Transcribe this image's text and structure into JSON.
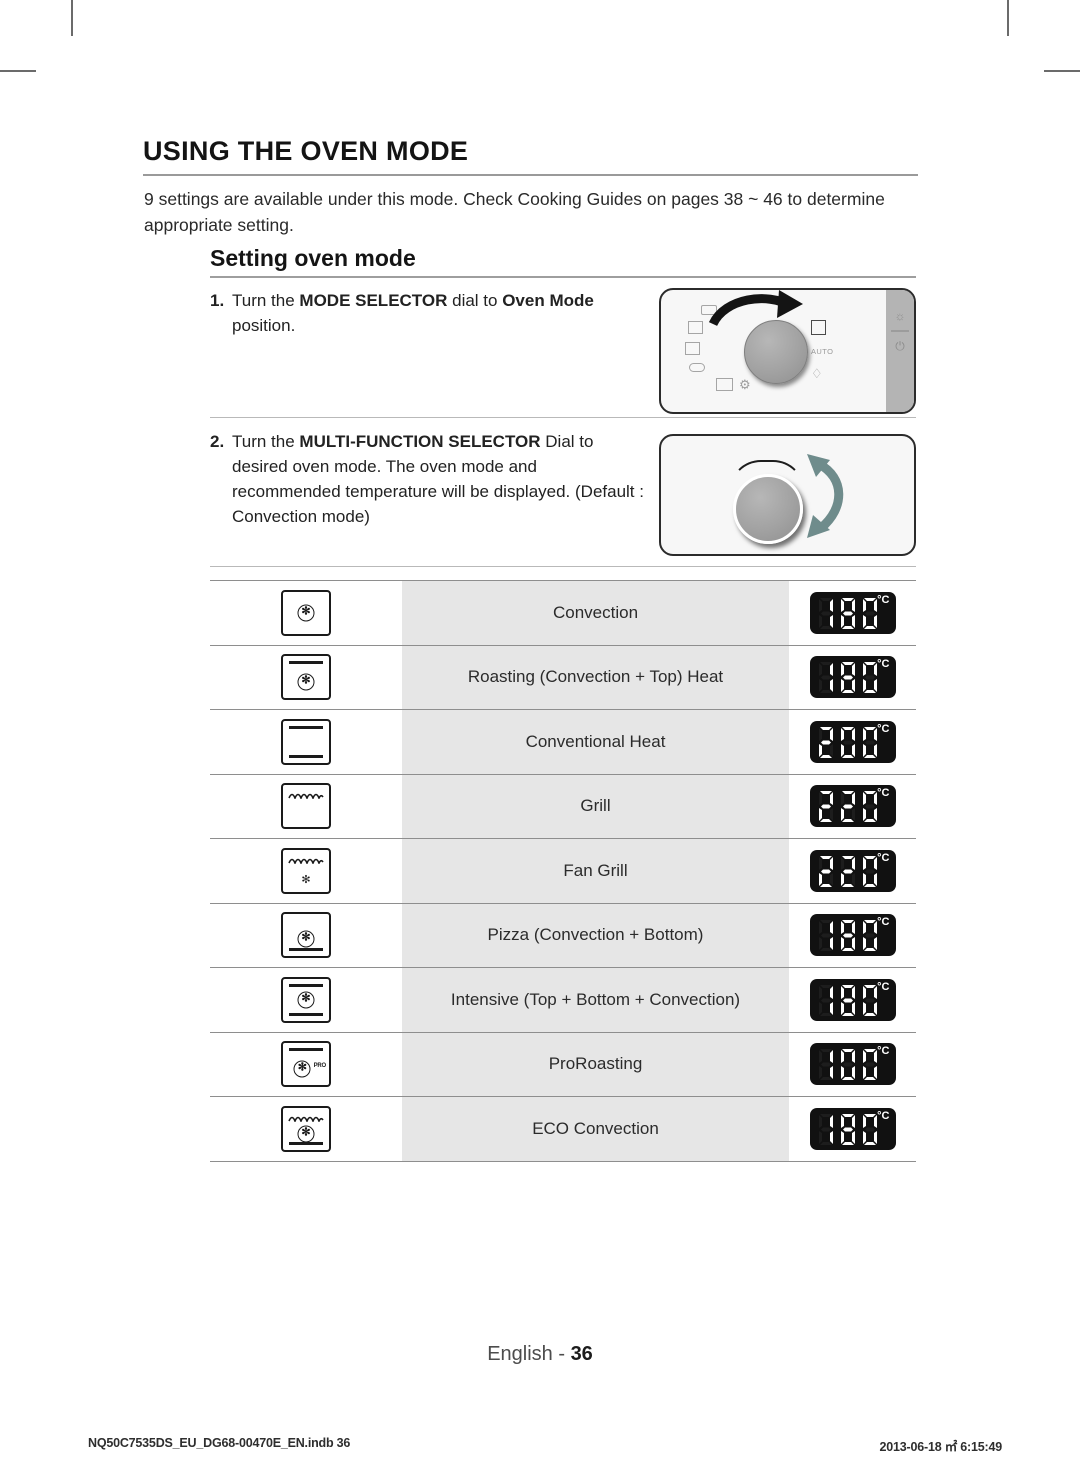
{
  "document": {
    "chapter_title": "USING THE OVEN MODE",
    "intro": "9 settings are available under this mode. Check Cooking Guides on pages 38 ~ 46 to determine appropriate setting.",
    "section_title": "Setting oven mode"
  },
  "steps": [
    {
      "number": "1.",
      "text_parts": [
        {
          "text": "Turn the ",
          "bold": false
        },
        {
          "text": "MODE SELECTOR",
          "bold": true
        },
        {
          "text": " dial to ",
          "bold": false
        },
        {
          "text": "Oven Mode",
          "bold": true
        },
        {
          "text": " position.",
          "bold": false
        }
      ]
    },
    {
      "number": "2.",
      "text_parts": [
        {
          "text": "Turn the ",
          "bold": false
        },
        {
          "text": "MULTI-FUNCTION SELECTOR",
          "bold": true
        },
        {
          "text": " Dial to desired oven mode. The oven mode and recommended temperature will be displayed. (Default : Convection mode)",
          "bold": false
        }
      ]
    }
  ],
  "panels": {
    "mode_selector": {
      "name": "mode-selector-panel",
      "knob": "mode-selector-knob",
      "arrow": "clockwise-turn-arrow",
      "auto_label": "AUTO"
    },
    "multi_function_selector": {
      "name": "multi-function-selector-panel",
      "knob": "multi-function-knob",
      "arrow": "bidirectional-turn-arrow",
      "arrow_color": "#6f8c8c"
    }
  },
  "mode_table": {
    "rows": [
      {
        "icon": "oven-convection-icon",
        "mode": "Convection",
        "temp": "180",
        "unit": "°C"
      },
      {
        "icon": "oven-roasting-icon",
        "mode": "Roasting (Convection + Top) Heat",
        "temp": "180",
        "unit": "°C"
      },
      {
        "icon": "oven-conventional-heat-icon",
        "mode": "Conventional Heat",
        "temp": "200",
        "unit": "°C"
      },
      {
        "icon": "oven-grill-icon",
        "mode": "Grill",
        "temp": "220",
        "unit": "°C"
      },
      {
        "icon": "oven-fan-grill-icon",
        "mode": "Fan Grill",
        "temp": "220",
        "unit": "°C"
      },
      {
        "icon": "oven-pizza-icon",
        "mode": "Pizza (Convection + Bottom)",
        "temp": "180",
        "unit": "°C"
      },
      {
        "icon": "oven-intensive-icon",
        "mode": "Intensive (Top + Bottom + Convection)",
        "temp": "180",
        "unit": "°C"
      },
      {
        "icon": "oven-proroasting-icon",
        "mode": "ProRoasting",
        "temp": "100",
        "unit": "°C"
      },
      {
        "icon": "oven-eco-convection-icon",
        "mode": "ECO Convection",
        "temp": "180",
        "unit": "°C"
      }
    ]
  },
  "footer": {
    "page_label": "English - ",
    "page_number": "36",
    "file_name": "NQ50C7535DS_EU_DG68-00470E_EN.indb   36",
    "timestamp": "2013-06-18   ㎡ 6:15:49"
  }
}
